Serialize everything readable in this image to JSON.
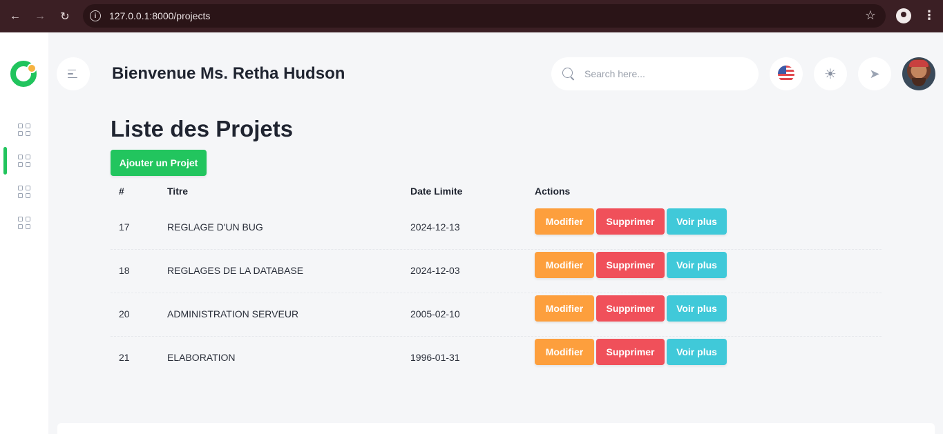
{
  "browser": {
    "url": "127.0.0.1:8000/projects",
    "back_icon": "arrow-left-icon",
    "forward_icon": "arrow-right-icon",
    "reload_icon": "reload-icon"
  },
  "header": {
    "welcome": "Bienvenue Ms. Retha Hudson",
    "search_placeholder": "Search here..."
  },
  "page": {
    "title": "Liste des Projets",
    "add_button": "Ajouter un Projet"
  },
  "table": {
    "columns": [
      "#",
      "Titre",
      "Date Limite",
      "Actions"
    ],
    "rows": [
      {
        "id": "17",
        "title": "REGLAGE D'UN BUG",
        "deadline": "2024-12-13"
      },
      {
        "id": "18",
        "title": "REGLAGES DE LA DATABASE",
        "deadline": "2024-12-03"
      },
      {
        "id": "20",
        "title": "ADMINISTRATION SERVEUR",
        "deadline": "2005-02-10"
      },
      {
        "id": "21",
        "title": "ELABORATION",
        "deadline": "1996-01-31"
      }
    ],
    "actions": {
      "edit": "Modifier",
      "delete": "Supprimer",
      "view": "Voir plus"
    }
  },
  "colors": {
    "accent": "#22c55e",
    "edit": "#fd9f3d",
    "delete": "#f0505a",
    "view": "#40c9d9"
  }
}
